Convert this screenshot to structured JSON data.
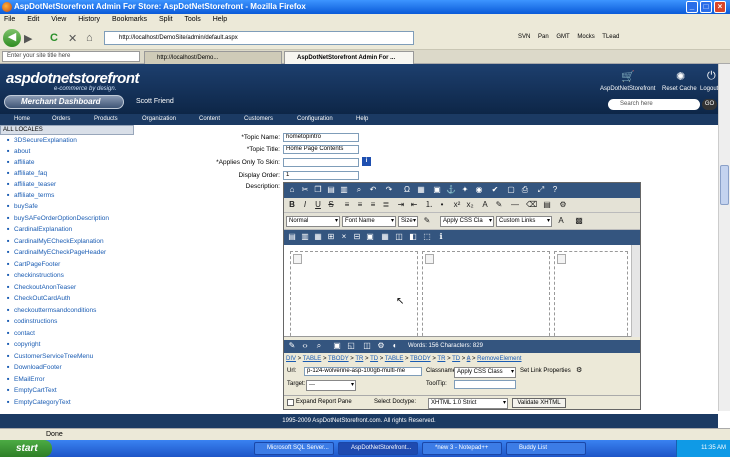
{
  "window": {
    "title": "AspDotNetStorefront Admin For Store: AspDotNetStorefront - Mozilla Firefox",
    "min": "_",
    "max": "□",
    "close": "×"
  },
  "menubar": [
    "File",
    "Edit",
    "View",
    "History",
    "Bookmarks",
    "Split",
    "Tools",
    "Help"
  ],
  "navbar": {
    "back": "◀",
    "forward": "▶",
    "reload": "C",
    "stop": "✕",
    "home": "⌂",
    "url": "http://localhost/DemoSite/admin/default.aspx",
    "bookmarks": [
      "SVN",
      "Pan",
      "GMT",
      "Mocks",
      "TLead"
    ]
  },
  "tabbar": {
    "search_placeholder": "Enter your site title here",
    "tabs": [
      "http://localhost/Demo...",
      "AspDotNetStorefront Admin For ..."
    ]
  },
  "header": {
    "logo": "aspdotnetstorefront",
    "logo_sub": "e-commerce by design.",
    "dashboard": "Merchant Dashboard",
    "user": "Scott Friend",
    "links": [
      "AspDotNetStorefront",
      "Reset Cache",
      "Logout"
    ],
    "search_placeholder": "Search here",
    "go": "GO"
  },
  "mainnav": [
    "Home",
    "Orders",
    "Products",
    "Organization",
    "Content",
    "Customers",
    "Configuration",
    "Help"
  ],
  "sidebar": {
    "locales": "ALL LOCALES",
    "topics": [
      "3DSecureExplanation",
      "about",
      "affiliate",
      "affiliate_faq",
      "affiliate_teaser",
      "affiliate_terms",
      "buySafe",
      "buySAFeOrderOptionDescription",
      "CardinalExplanation",
      "CardinalMyECheckExplanation",
      "CardinalMyECheckPageHeader",
      "CartPageFooter",
      "checkinstructions",
      "CheckoutAnonTeaser",
      "CheckOutCardAuth",
      "checkouttermsandconditions",
      "codinstructions",
      "contact",
      "copyright",
      "CustomerServiceTreeMenu",
      "DownloadFooter",
      "EMailError",
      "EmptyCartText",
      "EmptyCategoryText"
    ]
  },
  "form": {
    "topic_name_label": "*Topic Name:",
    "topic_name": "hometopintro",
    "topic_title_label": "*Topic Title:",
    "topic_title": "Home Page Contents",
    "skin_label": "*Applies Only To Skin:",
    "skin": "",
    "display_order_label": "Display Order:",
    "display_order": "1",
    "description_label": "Description:",
    "info": "i"
  },
  "editor": {
    "format": "Normal",
    "font": "Font Name",
    "size": "Size",
    "css_class": "Apply CSS Cla",
    "custom_links": "Custom Links",
    "status": "Words: 156 Characters: 829",
    "crumbs": [
      "DIV",
      "TABLE",
      "TBODY",
      "TR",
      "TD",
      "TABLE",
      "TBODY",
      "TR",
      "TD",
      "A"
    ],
    "remove_element": "RemoveElement",
    "url_label": "Url:",
    "url_value": "p-124-wolverine-asp-100gb-multi-me",
    "classname_label": "Classname:",
    "classname_value": "Apply CSS Class",
    "set_link": "Set Link Properties",
    "target_label": "Target:",
    "target_value": "---",
    "tooltip_label": "ToolTip:",
    "expand_label": "Expand Report Pane",
    "doctype_label": "Select Doctype:",
    "doctype_value": "XHTML 1.0 Strict",
    "validate": "Validate XHTML"
  },
  "footer": "1995-2009 AspDotNetStorefront.com. All rights Reserved.",
  "status": "Done",
  "taskbar": {
    "start": "start",
    "tasks": [
      "Microsoft SQL Server...",
      "AspDotNetStorefront...",
      "*new 3 - Notepad++",
      "Buddy List"
    ],
    "time": "11:35 AM"
  }
}
